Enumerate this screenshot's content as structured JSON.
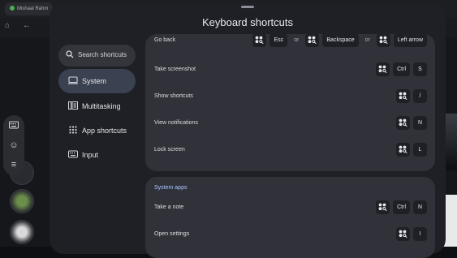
{
  "background": {
    "tab_title": "Mishaal Rahm"
  },
  "dialog": {
    "title": "Keyboard shortcuts"
  },
  "sidebar": {
    "search_label": "Search shortcuts",
    "items": [
      {
        "label": "System",
        "icon": "laptop-icon",
        "active": true
      },
      {
        "label": "Multitasking",
        "icon": "multitasking-icon",
        "active": false
      },
      {
        "label": "App shortcuts",
        "icon": "apps-grid-icon",
        "active": false
      },
      {
        "label": "Input",
        "icon": "keyboard-icon",
        "active": false
      }
    ]
  },
  "system_shortcuts": [
    {
      "name": "Go back",
      "combos": [
        [
          "launcher",
          "Esc"
        ],
        [
          "launcher",
          "Backspace"
        ],
        [
          "launcher",
          "Left arrow"
        ]
      ]
    },
    {
      "name": "Take screenshot",
      "combos": [
        [
          "launcher",
          "Ctrl",
          "S"
        ]
      ]
    },
    {
      "name": "Show shortcuts",
      "combos": [
        [
          "launcher",
          "/"
        ]
      ]
    },
    {
      "name": "View notifications",
      "combos": [
        [
          "launcher",
          "N"
        ]
      ]
    },
    {
      "name": "Lock screen",
      "combos": [
        [
          "launcher",
          "L"
        ]
      ]
    }
  ],
  "system_apps": {
    "title": "System apps",
    "shortcuts": [
      {
        "name": "Take a note",
        "combos": [
          [
            "launcher",
            "Ctrl",
            "N"
          ]
        ]
      },
      {
        "name": "Open settings",
        "combos": [
          [
            "launcher",
            "I"
          ]
        ]
      }
    ]
  },
  "or_label": "or",
  "colors": {
    "dialog_bg": "#1f2025",
    "card_bg": "#313239",
    "active_nav": "#3a4150",
    "section_accent": "#a9c7ff"
  }
}
